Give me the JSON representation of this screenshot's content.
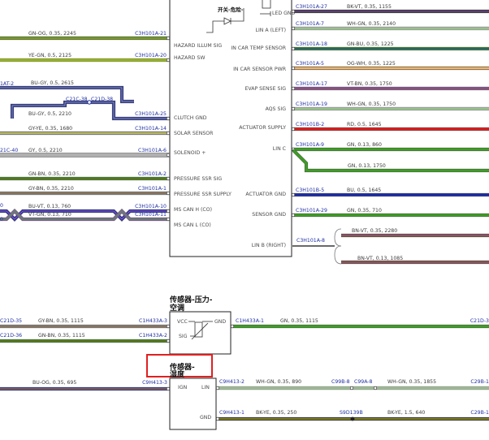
{
  "hvac_module": {
    "top_label": "开关-危险-",
    "led_gnd": "LED GND",
    "left_pins": [
      {
        "name": "HAZARD ILLUM SIG"
      },
      {
        "name": "HAZARD SW"
      },
      {
        "name": "CLUTCH GND"
      },
      {
        "name": "SOLAR SENSOR"
      },
      {
        "name": "SOLENOID +"
      },
      {
        "name": "PRESSURE SSR SIG"
      },
      {
        "name": "PRESSURE SSR SUPPLY"
      },
      {
        "name": "MS CAN H (CO)"
      },
      {
        "name": "MS CAN L (CO)"
      }
    ],
    "right_pins": [
      {
        "name": "LIN A (LEFT)"
      },
      {
        "name": "IN CAR TEMP SENSOR"
      },
      {
        "name": "IN CAR SENSOR PWR"
      },
      {
        "name": "EVAP SENSE SIG"
      },
      {
        "name": "AQS SIG"
      },
      {
        "name": "ACTUATOR SUPPLY"
      },
      {
        "name": "LIN C"
      },
      {
        "name": "ACTUATOR GND"
      },
      {
        "name": "SENSOR GND"
      },
      {
        "name": "LIN B (RIGHT)"
      }
    ]
  },
  "left_wires": [
    {
      "label": "GN-OG, 0.35, 2245",
      "pin": "C3H101A-21",
      "color": "#3aa020",
      "stripe": "#e08a1c"
    },
    {
      "label": "YE-GN, 0.5, 2125",
      "pin": "C3H101A-20",
      "color": "#d8d820",
      "stripe": "#3aa020"
    },
    {
      "label": "BU-GY, 0.5, 2615",
      "pin": "",
      "color": "#1a2aa8",
      "stripe": "#9a9a9a"
    },
    {
      "label": "BU-GY, 0.5, 2210",
      "pin": "C3H101A-25",
      "color": "#1a2aa8",
      "stripe": "#9a9a9a"
    },
    {
      "label": "GY-YE, 0.35, 1680",
      "pin": "C3H101A-14",
      "color": "#9a9a9a",
      "stripe": "#d8d820"
    },
    {
      "label": "GY, 0.5, 2210",
      "pin": "C3H101A-6",
      "color": "#b0b0b0",
      "stripe": ""
    },
    {
      "label": "GN-BN, 0.35, 2210",
      "pin": "C3H101A-2",
      "color": "#3aa020",
      "stripe": "#7a4a1a"
    },
    {
      "label": "GY-BN, 0.35, 2210",
      "pin": "C3H101A-1",
      "color": "#9a9a9a",
      "stripe": "#7a4a1a"
    },
    {
      "label": "BU-VT, 0.13, 760",
      "pin": "C3H101A-10",
      "color": "#1a2aa8",
      "stripe": "#9a5ac8"
    },
    {
      "label": "VT-GN, 0.13, 710",
      "pin": "C3H101A-11",
      "color": "#9a5ac8",
      "stripe": "#3aa020"
    }
  ],
  "left_extra": {
    "conn1": "1AT-2",
    "conn2": "C21C-38",
    "conn3": "C21D-38",
    "conn4": "21C-40",
    "frag_a": "0",
    "frag_b": "0"
  },
  "right_wires": [
    {
      "label": "BK-VT, 0.35, 1155",
      "pin": "C3H101A-27",
      "color": "#222222",
      "stripe": "#9a5ac8"
    },
    {
      "label": "WH-GN, 0.35, 2140",
      "pin": "C3H101A-7",
      "color": "#e8e8e8",
      "stripe": "#3aa020"
    },
    {
      "label": "GN-BU, 0.35, 1225",
      "pin": "C3H101A-18",
      "color": "#3aa020",
      "stripe": "#1a2aa8"
    },
    {
      "label": "OG-WH, 0.35, 1225",
      "pin": "C3H101A-5",
      "color": "#e08a1c",
      "stripe": "#e8e8e8"
    },
    {
      "label": "VT-BN, 0.35, 1750",
      "pin": "C3H101A-17",
      "color": "#9a5ac8",
      "stripe": "#7a4a1a"
    },
    {
      "label": "WH-GN, 0.35, 1750",
      "pin": "C3H101A-19",
      "color": "#e8e8e8",
      "stripe": "#3aa020"
    },
    {
      "label": "RD, 0.5, 1645",
      "pin": "C3H101B-2",
      "color": "#e01a1a",
      "stripe": ""
    },
    {
      "label": "GN, 0.13, 860",
      "pin": "C3H101A-9",
      "color": "#3aa020",
      "stripe": ""
    },
    {
      "label": "GN, 0.13, 1750",
      "pin": "",
      "color": "#3aa020",
      "stripe": ""
    },
    {
      "label": "BU, 0.5, 1645",
      "pin": "C3H101B-5",
      "color": "#1a2aa8",
      "stripe": ""
    },
    {
      "label": "GN, 0.35, 710",
      "pin": "C3H101A-29",
      "color": "#3aa020",
      "stripe": ""
    },
    {
      "label": "BN-VT, 0.35, 2280",
      "pin": "C3H101A-8",
      "color": "#7a4a1a",
      "stripe": "#9a5ac8"
    },
    {
      "label": "BN-VT, 0.13, 1085",
      "pin": "",
      "color": "#7a4a1a",
      "stripe": "#9a5ac8"
    }
  ],
  "pressure_sensor": {
    "title_line1": "传感器-压力-",
    "title_line2": "空调",
    "pin_vcc": "VCC",
    "pin_gnd": "GND",
    "pin_sig": "SIG",
    "wires": [
      {
        "left_label": "GY-BN, 0.35, 1115",
        "left_conn": "C21D-35",
        "pin": "C1H433A-3",
        "color": "#9a9a9a",
        "stripe": "#7a4a1a"
      },
      {
        "left_label": "GN-BN, 0.35, 1115",
        "left_conn": "C21D-36",
        "pin": "C1H433A-2",
        "color": "#3aa020",
        "stripe": "#7a4a1a"
      }
    ],
    "right_wire": {
      "pin": "C1H433A-1",
      "label": "GN, 0.35, 1115",
      "end_conn": "C21D-3",
      "color": "#3aa020"
    }
  },
  "humidity_sensor": {
    "title_line1": "传感器-",
    "title_line2": "湿度",
    "pin_ign": "IGN",
    "pin_lin": "LIN",
    "pin_gnd": "GND",
    "left_wire": {
      "label": "BU-OG, 0.35, 695",
      "left_conn": "",
      "pin": "C9H413-3",
      "color": "#1a2aa8",
      "stripe": "#e08a1c"
    },
    "lin_wire": {
      "pin": "C9H413-2",
      "label1": "WH-GN, 0.35, 890",
      "conn_a": "C99B-8",
      "conn_b": "C99A-8",
      "label2": "WH-GN, 0.35, 1855",
      "end_conn": "C29B-1"
    },
    "gnd_wire": {
      "pin": "C9H413-1",
      "label1": "BK-YE, 0.35, 250",
      "splice": "S9D139B",
      "label2": "BK-YE, 1.5, 640",
      "end_conn": "C29B-1"
    }
  },
  "colors": {
    "highlight_box": "#e02020",
    "connector_text": "#1f2fa0",
    "module_outline": "#222222"
  }
}
